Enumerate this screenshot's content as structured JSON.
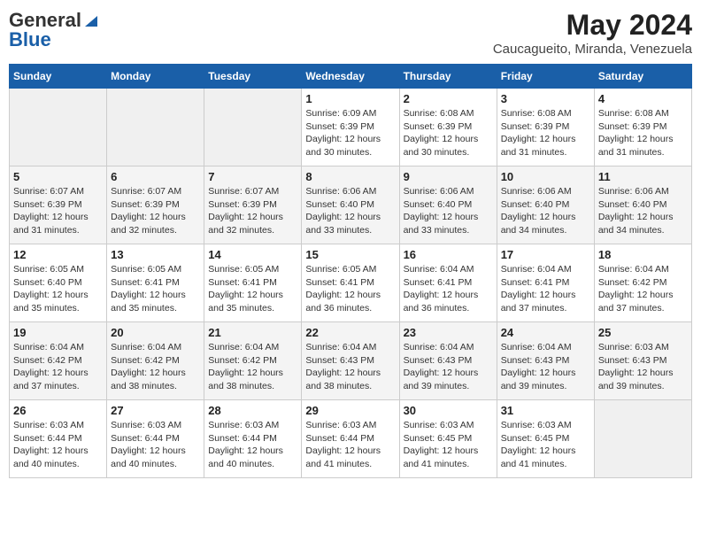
{
  "header": {
    "logo_general": "General",
    "logo_blue": "Blue",
    "title": "May 2024",
    "subtitle": "Caucagueito, Miranda, Venezuela"
  },
  "weekdays": [
    "Sunday",
    "Monday",
    "Tuesday",
    "Wednesday",
    "Thursday",
    "Friday",
    "Saturday"
  ],
  "weeks": [
    [
      {
        "day": "",
        "info": ""
      },
      {
        "day": "",
        "info": ""
      },
      {
        "day": "",
        "info": ""
      },
      {
        "day": "1",
        "info": "Sunrise: 6:09 AM\nSunset: 6:39 PM\nDaylight: 12 hours\nand 30 minutes."
      },
      {
        "day": "2",
        "info": "Sunrise: 6:08 AM\nSunset: 6:39 PM\nDaylight: 12 hours\nand 30 minutes."
      },
      {
        "day": "3",
        "info": "Sunrise: 6:08 AM\nSunset: 6:39 PM\nDaylight: 12 hours\nand 31 minutes."
      },
      {
        "day": "4",
        "info": "Sunrise: 6:08 AM\nSunset: 6:39 PM\nDaylight: 12 hours\nand 31 minutes."
      }
    ],
    [
      {
        "day": "5",
        "info": "Sunrise: 6:07 AM\nSunset: 6:39 PM\nDaylight: 12 hours\nand 31 minutes."
      },
      {
        "day": "6",
        "info": "Sunrise: 6:07 AM\nSunset: 6:39 PM\nDaylight: 12 hours\nand 32 minutes."
      },
      {
        "day": "7",
        "info": "Sunrise: 6:07 AM\nSunset: 6:39 PM\nDaylight: 12 hours\nand 32 minutes."
      },
      {
        "day": "8",
        "info": "Sunrise: 6:06 AM\nSunset: 6:40 PM\nDaylight: 12 hours\nand 33 minutes."
      },
      {
        "day": "9",
        "info": "Sunrise: 6:06 AM\nSunset: 6:40 PM\nDaylight: 12 hours\nand 33 minutes."
      },
      {
        "day": "10",
        "info": "Sunrise: 6:06 AM\nSunset: 6:40 PM\nDaylight: 12 hours\nand 34 minutes."
      },
      {
        "day": "11",
        "info": "Sunrise: 6:06 AM\nSunset: 6:40 PM\nDaylight: 12 hours\nand 34 minutes."
      }
    ],
    [
      {
        "day": "12",
        "info": "Sunrise: 6:05 AM\nSunset: 6:40 PM\nDaylight: 12 hours\nand 35 minutes."
      },
      {
        "day": "13",
        "info": "Sunrise: 6:05 AM\nSunset: 6:41 PM\nDaylight: 12 hours\nand 35 minutes."
      },
      {
        "day": "14",
        "info": "Sunrise: 6:05 AM\nSunset: 6:41 PM\nDaylight: 12 hours\nand 35 minutes."
      },
      {
        "day": "15",
        "info": "Sunrise: 6:05 AM\nSunset: 6:41 PM\nDaylight: 12 hours\nand 36 minutes."
      },
      {
        "day": "16",
        "info": "Sunrise: 6:04 AM\nSunset: 6:41 PM\nDaylight: 12 hours\nand 36 minutes."
      },
      {
        "day": "17",
        "info": "Sunrise: 6:04 AM\nSunset: 6:41 PM\nDaylight: 12 hours\nand 37 minutes."
      },
      {
        "day": "18",
        "info": "Sunrise: 6:04 AM\nSunset: 6:42 PM\nDaylight: 12 hours\nand 37 minutes."
      }
    ],
    [
      {
        "day": "19",
        "info": "Sunrise: 6:04 AM\nSunset: 6:42 PM\nDaylight: 12 hours\nand 37 minutes."
      },
      {
        "day": "20",
        "info": "Sunrise: 6:04 AM\nSunset: 6:42 PM\nDaylight: 12 hours\nand 38 minutes."
      },
      {
        "day": "21",
        "info": "Sunrise: 6:04 AM\nSunset: 6:42 PM\nDaylight: 12 hours\nand 38 minutes."
      },
      {
        "day": "22",
        "info": "Sunrise: 6:04 AM\nSunset: 6:43 PM\nDaylight: 12 hours\nand 38 minutes."
      },
      {
        "day": "23",
        "info": "Sunrise: 6:04 AM\nSunset: 6:43 PM\nDaylight: 12 hours\nand 39 minutes."
      },
      {
        "day": "24",
        "info": "Sunrise: 6:04 AM\nSunset: 6:43 PM\nDaylight: 12 hours\nand 39 minutes."
      },
      {
        "day": "25",
        "info": "Sunrise: 6:03 AM\nSunset: 6:43 PM\nDaylight: 12 hours\nand 39 minutes."
      }
    ],
    [
      {
        "day": "26",
        "info": "Sunrise: 6:03 AM\nSunset: 6:44 PM\nDaylight: 12 hours\nand 40 minutes."
      },
      {
        "day": "27",
        "info": "Sunrise: 6:03 AM\nSunset: 6:44 PM\nDaylight: 12 hours\nand 40 minutes."
      },
      {
        "day": "28",
        "info": "Sunrise: 6:03 AM\nSunset: 6:44 PM\nDaylight: 12 hours\nand 40 minutes."
      },
      {
        "day": "29",
        "info": "Sunrise: 6:03 AM\nSunset: 6:44 PM\nDaylight: 12 hours\nand 41 minutes."
      },
      {
        "day": "30",
        "info": "Sunrise: 6:03 AM\nSunset: 6:45 PM\nDaylight: 12 hours\nand 41 minutes."
      },
      {
        "day": "31",
        "info": "Sunrise: 6:03 AM\nSunset: 6:45 PM\nDaylight: 12 hours\nand 41 minutes."
      },
      {
        "day": "",
        "info": ""
      }
    ]
  ]
}
